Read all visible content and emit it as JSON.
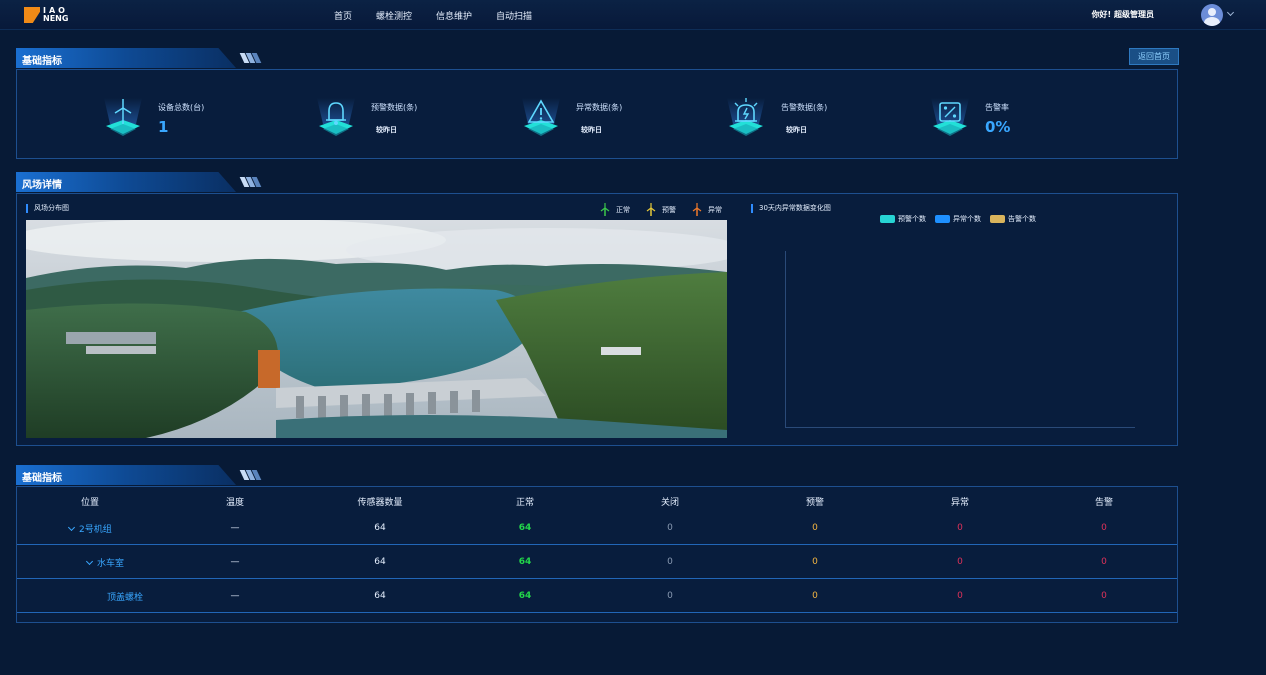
{
  "header": {
    "logo": {
      "line1": "IAO",
      "line2": "NENG",
      "line3": ""
    },
    "nav": [
      "首页",
      "螺栓测控",
      "信息维护",
      "自动扫描"
    ],
    "greeting": "你好! 超级管理员"
  },
  "section_basic": {
    "title": "基础指标",
    "back_button": "返回首页",
    "stats": [
      {
        "icon": "wind-turbine-icon",
        "label": "设备总数(台)",
        "value": "1",
        "sub": ""
      },
      {
        "icon": "bell-icon",
        "label": "预警数据(条)",
        "value": "",
        "sub": "较昨日"
      },
      {
        "icon": "warning-triangle-icon",
        "label": "异常数据(条)",
        "value": "",
        "sub": "较昨日"
      },
      {
        "icon": "alarm-light-icon",
        "label": "告警数据(条)",
        "value": "",
        "sub": "较昨日"
      },
      {
        "icon": "percent-icon",
        "label": "告警率",
        "value": "0%",
        "sub": ""
      }
    ]
  },
  "section_windfarm": {
    "title": "风场详情",
    "map_title": "风场分布图",
    "map_legend": [
      {
        "label": "正常",
        "color": "#3cc84b"
      },
      {
        "label": "预警",
        "color": "#e5c93a"
      },
      {
        "label": "异常",
        "color": "#f07a2a"
      }
    ],
    "chart_title": "30天内异常数据变化图",
    "chart_legend": [
      {
        "label": "预警个数",
        "color": "#27d4d4"
      },
      {
        "label": "异常个数",
        "color": "#1e90ff"
      },
      {
        "label": "告警个数",
        "color": "#d9b45c"
      }
    ]
  },
  "section_table": {
    "title": "基础指标",
    "columns": [
      "位置",
      "温度",
      "传感器数量",
      "正常",
      "关闭",
      "预警",
      "异常",
      "告警"
    ],
    "rows": [
      {
        "location": "2号机组",
        "expanded": true,
        "level": 0,
        "temperature": "—",
        "sensors": "64",
        "normal": "64",
        "closed": "0",
        "warning": "0",
        "abnormal": "0",
        "alarm": "0"
      },
      {
        "location": "水车室",
        "expanded": true,
        "level": 1,
        "temperature": "—",
        "sensors": "64",
        "normal": "64",
        "closed": "0",
        "warning": "0",
        "abnormal": "0",
        "alarm": "0"
      },
      {
        "location": "顶盖螺栓",
        "expanded": false,
        "level": 2,
        "temperature": "—",
        "sensors": "64",
        "normal": "64",
        "closed": "0",
        "warning": "0",
        "abnormal": "0",
        "alarm": "0"
      }
    ]
  },
  "colors": {
    "normal": "#22d64a",
    "closed": "#8a9bb3",
    "warning": "#f5b642",
    "abnormal": "#e0325a",
    "alarm": "#e0325a",
    "accent": "#39a7ff"
  }
}
